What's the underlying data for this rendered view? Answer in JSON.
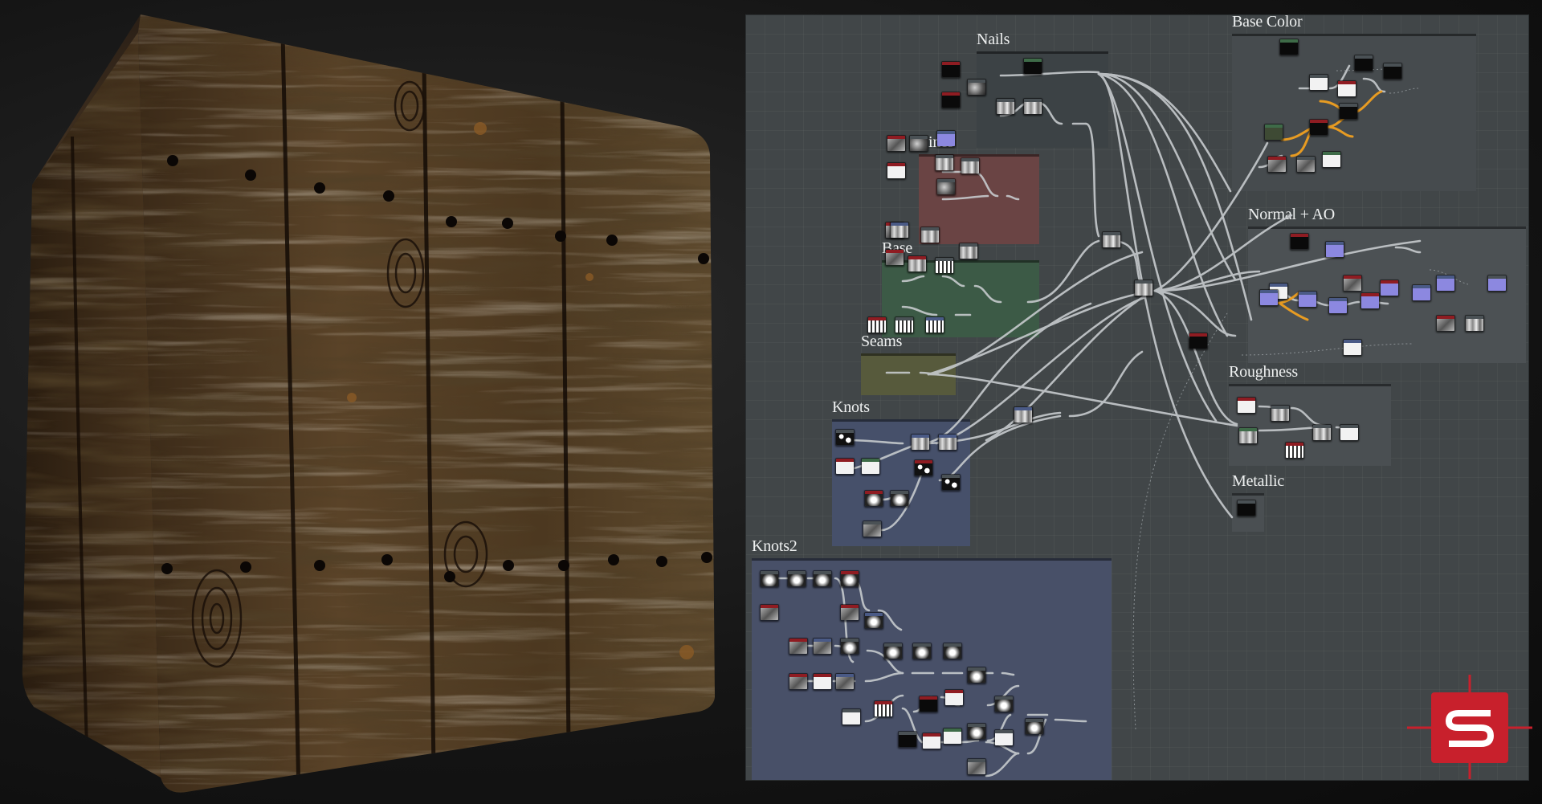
{
  "colors": {
    "graph_bg": "#414648",
    "wire": "#c9cdd0",
    "wire_highlight": "#f0a020",
    "node_header_red": "#8f1c22",
    "node_header_grey": "#4a5155",
    "node_header_green": "#3e6b48",
    "node_header_blue": "#4a5a86",
    "logo_red": "#c8202c"
  },
  "icons": {
    "logo": "substance-designer-logo-icon"
  },
  "frames": [
    {
      "title": "Nails",
      "color": "#3c4245"
    },
    {
      "title": "Lines",
      "color": "#6a4444"
    },
    {
      "title": "Base",
      "color": "#3c5a46"
    },
    {
      "title": "Seams",
      "color": "#575a3c"
    },
    {
      "title": "Knots",
      "color": "#46506a"
    },
    {
      "title": "Knots2",
      "color": "#485068"
    },
    {
      "title": "Base Color",
      "color": "#464b4e"
    },
    {
      "title": "Normal + AO",
      "color": "#4c5154"
    },
    {
      "title": "Roughness",
      "color": "#4a4f52"
    },
    {
      "title": "Metallic",
      "color": "#4a4f52"
    }
  ]
}
